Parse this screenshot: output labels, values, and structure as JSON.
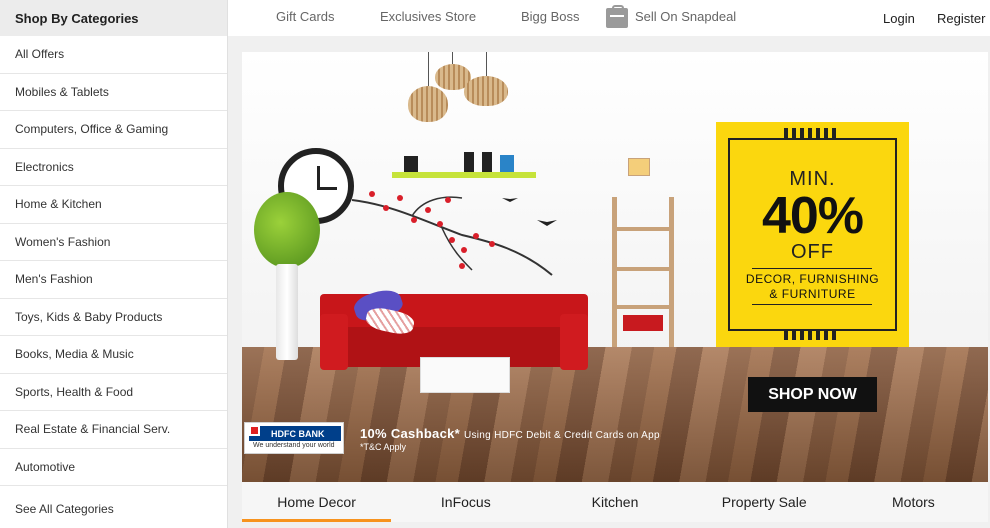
{
  "sidebar": {
    "header": "Shop By Categories",
    "items": [
      {
        "label": "All Offers"
      },
      {
        "label": "Mobiles & Tablets"
      },
      {
        "label": "Computers, Office & Gaming"
      },
      {
        "label": "Electronics"
      },
      {
        "label": "Home & Kitchen"
      },
      {
        "label": "Women's Fashion"
      },
      {
        "label": "Men's Fashion"
      },
      {
        "label": "Toys, Kids & Baby Products"
      },
      {
        "label": "Books, Media & Music"
      },
      {
        "label": "Sports, Health & Food"
      },
      {
        "label": "Real Estate & Financial Serv."
      },
      {
        "label": "Automotive"
      }
    ],
    "see_all": "See All Categories"
  },
  "topnav": {
    "links": [
      "Gift Cards",
      "Exclusives Store",
      "Bigg Boss"
    ],
    "sell": "Sell On Snapdeal",
    "login": "Login",
    "register": "Register"
  },
  "banner": {
    "promo_min": "MIN.",
    "promo_percent": "40%",
    "promo_off": "OFF",
    "promo_sub1": "DECOR, FURNISHING",
    "promo_sub2": "& FURNITURE",
    "shop_now": "SHOP NOW",
    "bank_name": "HDFC BANK",
    "bank_tagline": "We understand your world",
    "cashback": "10% Cashback*",
    "cashback_detail": "Using HDFC Debit & Credit Cards on App",
    "tnc": "*T&C Apply",
    "colors": {
      "promo_bg": "#fbd70e",
      "sofa": "#c8161a",
      "bank_blue": "#003f8a"
    }
  },
  "tabs": [
    {
      "label": "Home Decor",
      "active": true
    },
    {
      "label": "InFocus",
      "active": false
    },
    {
      "label": "Kitchen",
      "active": false
    },
    {
      "label": "Property Sale",
      "active": false
    },
    {
      "label": "Motors",
      "active": false
    }
  ],
  "accent_color": "#f7931e"
}
